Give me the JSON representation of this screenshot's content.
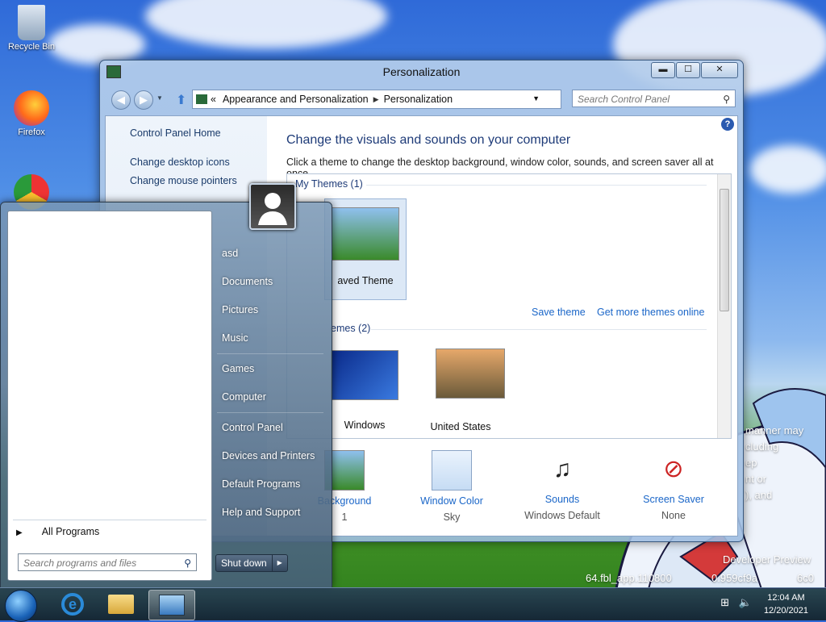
{
  "desktop": {
    "icons": [
      {
        "label": "Recycle Bin"
      },
      {
        "label": "Firefox"
      }
    ],
    "watermark_lines": [
      "manner may",
      "cluding",
      "ep",
      "nt or",
      "), and",
      "Developer Preview",
      "64.fbl_app.110800",
      "0.959cf9a",
      "6c0"
    ]
  },
  "window": {
    "title": "Personalization",
    "buttons": {
      "minimize": "▬",
      "maximize": "☐",
      "close": "✕"
    },
    "address": {
      "prefix": "«",
      "crumb1": "Appearance and Personalization",
      "crumb2": "Personalization"
    },
    "search_placeholder": "Search Control Panel",
    "left_pane": {
      "home": "Control Panel Home",
      "links": [
        "Change desktop icons",
        "Change mouse pointers"
      ]
    },
    "heading": "Change the visuals and sounds on your computer",
    "subtext": "Click a theme to change the desktop background, window color, sounds, and screen saver all at once.",
    "my_themes_label": "My Themes (1)",
    "saved_theme_label": "aved Theme",
    "save_theme_link": "Save theme",
    "more_themes_link": "Get more themes online",
    "aero_themes_label": "emes (2)",
    "themes": [
      {
        "label": "Windows"
      },
      {
        "label": "United States"
      }
    ],
    "bottom": [
      {
        "label": "Background",
        "value": "1"
      },
      {
        "label": "Window Color",
        "value": "Sky"
      },
      {
        "label": "Sounds",
        "value": "Windows Default"
      },
      {
        "label": "Screen Saver",
        "value": "None"
      }
    ]
  },
  "start_menu": {
    "right_items": [
      "asd",
      "Documents",
      "Pictures",
      "Music",
      "Games",
      "Computer",
      "Control Panel",
      "Devices and Printers",
      "Default Programs",
      "Help and Support"
    ],
    "all_programs": "All Programs",
    "search_placeholder": "Search programs and files",
    "shutdown": "Shut down"
  },
  "taskbar": {
    "time": "12:04 AM",
    "date": "12/20/2021"
  }
}
